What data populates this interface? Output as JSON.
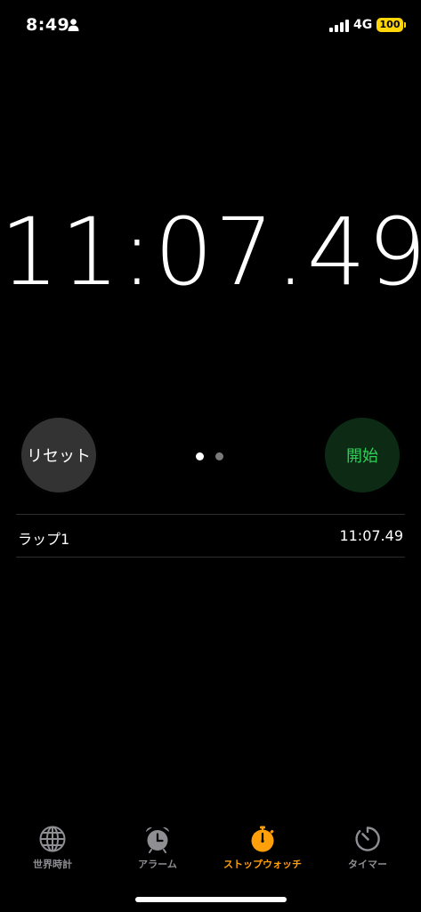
{
  "status_bar": {
    "time": "8:49",
    "network": "4G",
    "battery": "100",
    "icons": [
      "person-icon",
      "signal-icon"
    ]
  },
  "stopwatch": {
    "display": "11:07.49",
    "page_indicator": {
      "count": 2,
      "active": 0
    }
  },
  "buttons": {
    "reset_label": "リセット",
    "start_label": "開始"
  },
  "laps": [
    {
      "label": "ラップ1",
      "time": "11:07.49"
    }
  ],
  "tabs": [
    {
      "label": "世界時計",
      "icon": "globe-icon"
    },
    {
      "label": "アラーム",
      "icon": "alarm-clock-icon"
    },
    {
      "label": "ストップウォッチ",
      "icon": "stopwatch-icon",
      "active": true
    },
    {
      "label": "タイマー",
      "icon": "timer-icon"
    }
  ],
  "colors": {
    "accent": "#ff9f0a",
    "start_text": "#30d158",
    "start_bg": "#0c2a14",
    "reset_bg": "#333333",
    "battery": "#ffd60a"
  }
}
